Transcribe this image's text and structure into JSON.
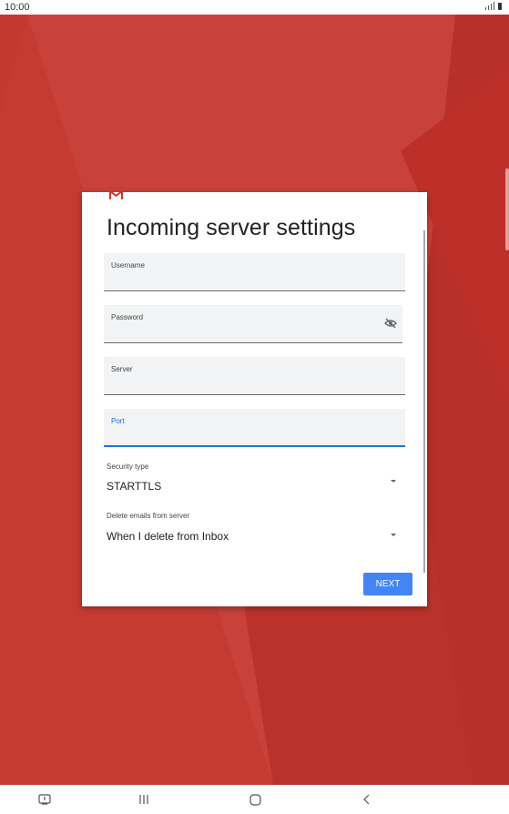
{
  "status_bar": {
    "time": "10:00"
  },
  "dialog": {
    "title": "Incoming server settings",
    "fields": {
      "username": {
        "label": "Username",
        "value": ""
      },
      "password": {
        "label": "Password",
        "value": ""
      },
      "server": {
        "label": "Server",
        "value": ""
      },
      "port": {
        "label": "Port",
        "value": ""
      }
    },
    "security_type": {
      "label": "Security type",
      "value": "STARTTLS"
    },
    "delete_emails": {
      "label": "Delete emails from server",
      "value": "When I delete from Inbox"
    },
    "next_label": "NEXT"
  },
  "colors": {
    "background": "#c6362f",
    "accent": "#4285f4",
    "focus": "#1a73e8"
  },
  "icons": [
    "gmail-icon",
    "visibility-off-icon",
    "dropdown-arrow-icon",
    "screenshot-icon",
    "recent-apps-icon",
    "home-icon",
    "back-icon"
  ]
}
